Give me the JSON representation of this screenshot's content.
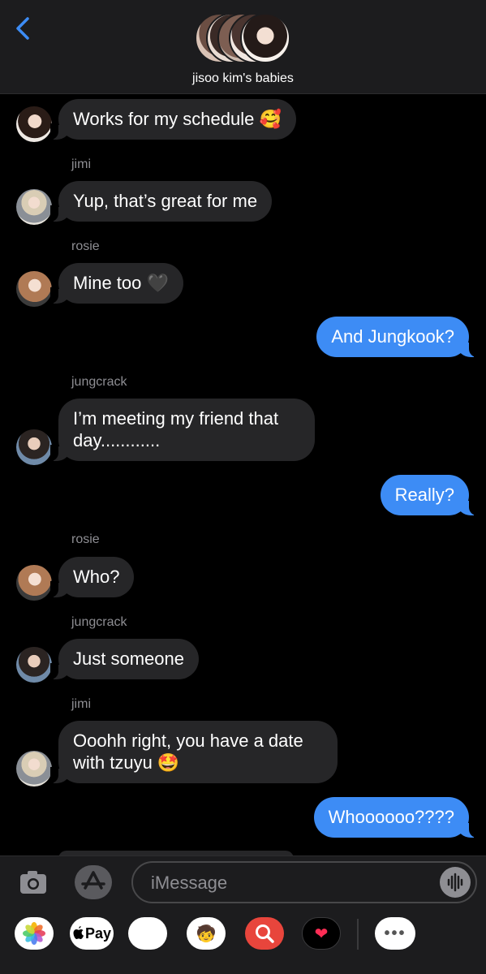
{
  "header": {
    "group_name": "jisoo kim's babies",
    "back_icon": "chevron-left-icon",
    "accent": "#3d8cf5"
  },
  "messages": [
    {
      "direction": "incoming",
      "sender": "",
      "avatar": "jisoo",
      "text": "Works for my schedule 🥰"
    },
    {
      "direction": "incoming",
      "sender": "jimi",
      "avatar": "jimi",
      "text": "Yup, that’s great for me"
    },
    {
      "direction": "incoming",
      "sender": "rosie",
      "avatar": "rosie",
      "text": "Mine too 🖤"
    },
    {
      "direction": "outgoing",
      "text": "And Jungkook?"
    },
    {
      "direction": "incoming",
      "sender": "jungcrack",
      "avatar": "jungkook",
      "text_line1": "I’m meeting my friend that",
      "text_line2": "day............"
    },
    {
      "direction": "outgoing",
      "text": "Really?"
    },
    {
      "direction": "incoming",
      "sender": "rosie",
      "avatar": "rosie",
      "text": "Who?"
    },
    {
      "direction": "incoming",
      "sender": "jungcrack",
      "avatar": "jungkook",
      "text": "Just someone"
    },
    {
      "direction": "incoming",
      "sender": "jimi",
      "avatar": "jimi",
      "text_line1": "Ooohh right, you have a date",
      "text_line2": "with tzuyu 🤩"
    },
    {
      "direction": "outgoing",
      "text": "Whoooooo????"
    }
  ],
  "composer": {
    "placeholder": "iMessage",
    "camera_icon": "camera-icon",
    "appstore_icon": "app-store-icon",
    "audio_icon": "audio-waveform-icon"
  },
  "app_drawer": {
    "photos": "photos-app-icon",
    "pay_label": "Pay",
    "animoji": "🐵",
    "memoji": "🧒",
    "search": "image-search-icon",
    "digital_touch": "❤",
    "more": "•••"
  },
  "colors": {
    "incoming_bubble": "#262628",
    "outgoing_bubble": "#3d8cf5",
    "background": "#000000",
    "sender_label": "#8e8e93"
  }
}
